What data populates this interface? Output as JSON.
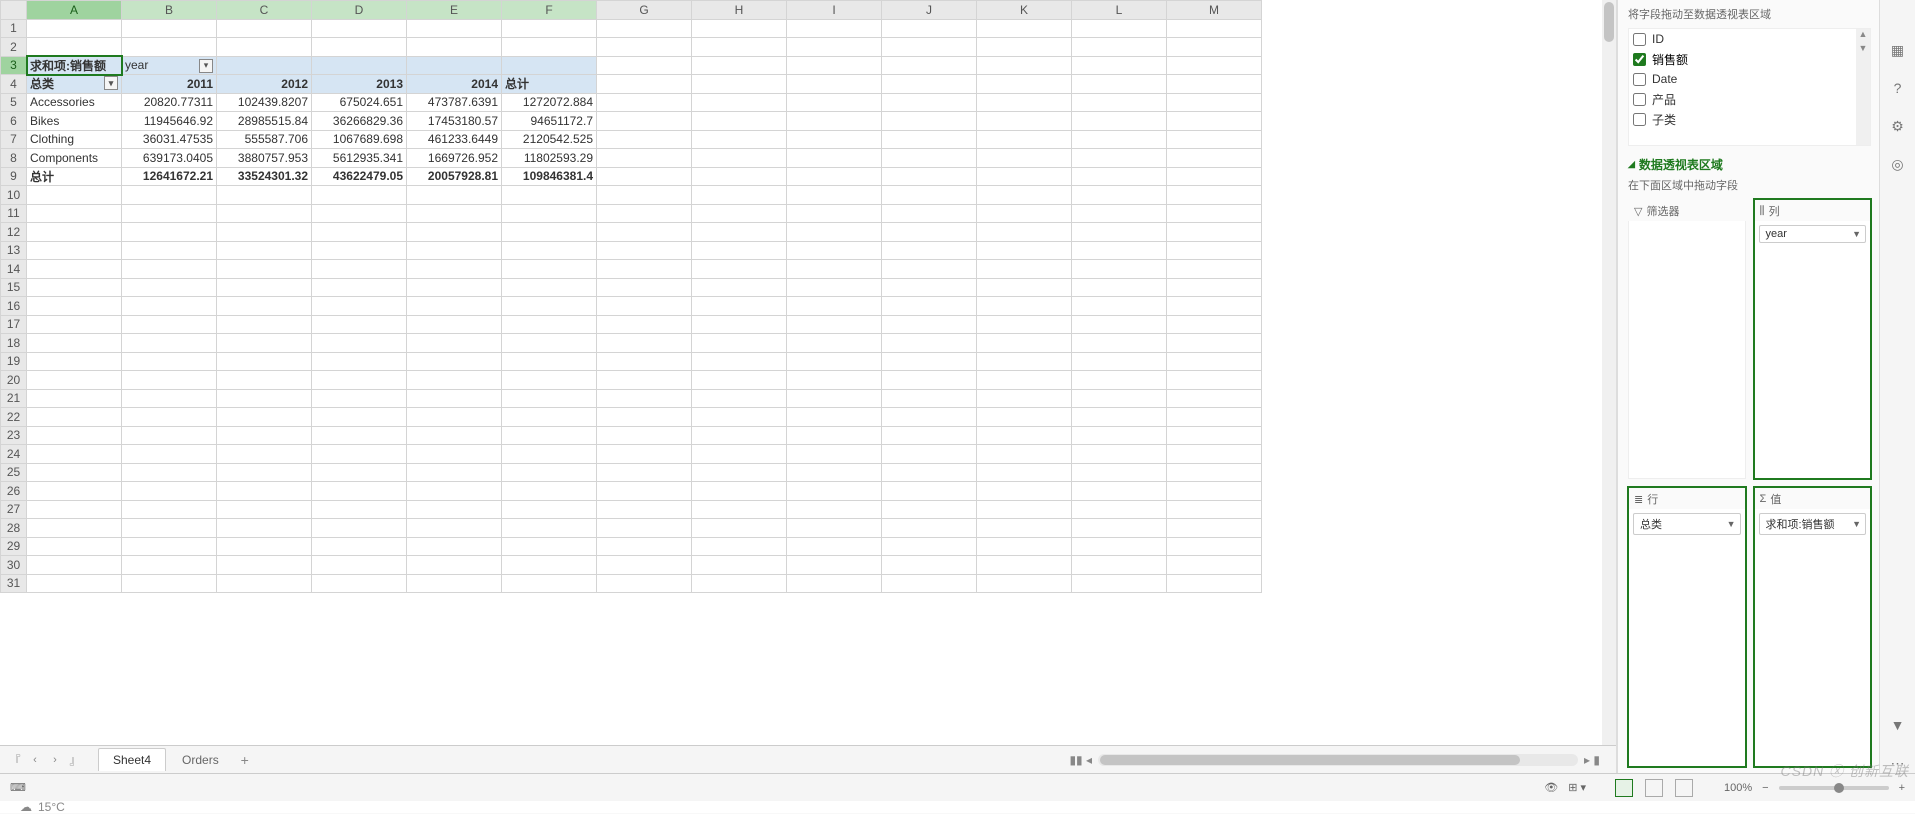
{
  "columns": [
    "A",
    "B",
    "C",
    "D",
    "E",
    "F",
    "G",
    "H",
    "I",
    "J",
    "K",
    "L",
    "M"
  ],
  "row_count": 31,
  "pivot": {
    "measure_label": "求和项:销售额",
    "col_field": "year",
    "row_headers": [
      "总类",
      "2011",
      "2012",
      "2013",
      "2014",
      "总计"
    ],
    "rows": [
      {
        "label": "Accessories",
        "v": [
          "20820.77311",
          "102439.8207",
          "675024.651",
          "473787.6391",
          "1272072.884"
        ]
      },
      {
        "label": "Bikes",
        "v": [
          "11945646.92",
          "28985515.84",
          "36266829.36",
          "17453180.57",
          "94651172.7"
        ]
      },
      {
        "label": "Clothing",
        "v": [
          "36031.47535",
          "555587.706",
          "1067689.698",
          "461233.6449",
          "2120542.525"
        ]
      },
      {
        "label": "Components",
        "v": [
          "639173.0405",
          "3880757.953",
          "5612935.341",
          "1669726.952",
          "11802593.29"
        ]
      }
    ],
    "totals": {
      "label": "总计",
      "v": [
        "12641672.21",
        "33524301.32",
        "43622479.05",
        "20057928.81",
        "109846381.4"
      ]
    }
  },
  "tabs": {
    "active": "Sheet4",
    "other": "Orders"
  },
  "panel": {
    "hint": "将字段拖动至数据透视表区域",
    "fields": [
      {
        "name": "ID",
        "checked": false
      },
      {
        "name": "销售额",
        "checked": true
      },
      {
        "name": "Date",
        "checked": false
      },
      {
        "name": "产品",
        "checked": false
      },
      {
        "name": "子类",
        "checked": false
      }
    ],
    "area_title": "数据透视表区域",
    "area_sub": "在下面区域中拖动字段",
    "zones": {
      "filter": {
        "label": "筛选器"
      },
      "cols": {
        "label": "列",
        "chip": "year"
      },
      "rows": {
        "label": "行",
        "chip": "总类"
      },
      "vals": {
        "label": "值",
        "chip": "求和项:销售额"
      }
    }
  },
  "status": {
    "zoom": "100%",
    "temp": "15°C"
  },
  "watermark": "CSDN ⓧ 创新互联"
}
